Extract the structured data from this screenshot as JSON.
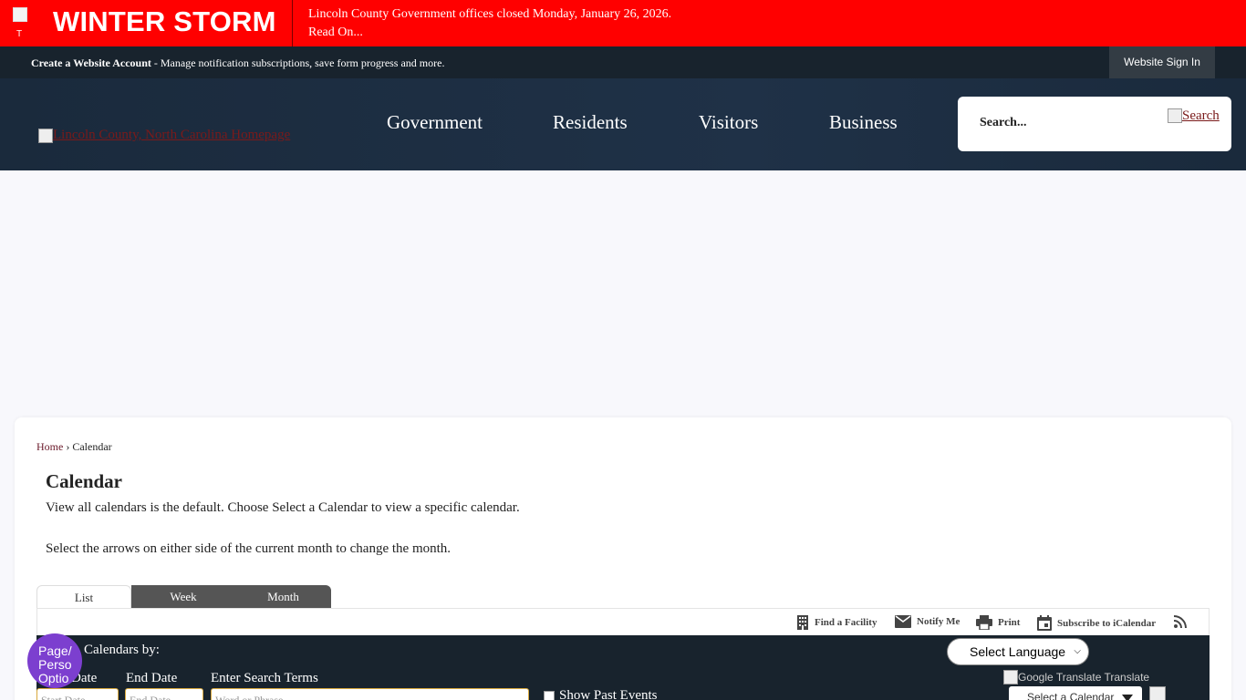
{
  "alert": {
    "title": "WINTER STORM",
    "icon_alt": "T",
    "message_line1": "Lincoln County Government offices closed Monday, January 26, 2026.",
    "message_line2": "Read On..."
  },
  "account_bar": {
    "create_account": "Create a Website Account",
    "create_account_desc": " - Manage notification subscriptions, save form progress and more.",
    "sign_in": "Website Sign In"
  },
  "header": {
    "logo_alt": "Lincoln County, North Carolina Homepage",
    "nav": [
      "Government",
      "Residents",
      "Visitors",
      "Business"
    ],
    "search_placeholder": "Search...",
    "search_button": "Search"
  },
  "breadcrumb": {
    "home": "Home",
    "separator": " › ",
    "current": "Calendar"
  },
  "page": {
    "title": "Calendar",
    "desc1": "View all calendars is the default. Choose Select a Calendar to view a specific calendar.",
    "desc2": "Select the arrows on either side of the current month to change the month."
  },
  "tabs": {
    "list": "List",
    "week": "Week",
    "month": "Month"
  },
  "toolbar": {
    "find_facility": "Find a Facility",
    "notify_me": "Notify Me",
    "print": "Print",
    "subscribe": "Subscribe to iCalendar"
  },
  "filter": {
    "title": "Calendars by:",
    "language": "Select Language",
    "google_translate": "Google Translate Translate",
    "start_date_label": "Date",
    "start_date_placeholder": "Start Date",
    "end_date_label": "End Date",
    "end_date_placeholder": "End Date",
    "search_terms_label": "Enter Search Terms",
    "search_terms_placeholder": "Word or Phrase",
    "show_past": "Show Past Events",
    "calendar_select": "Select a Calendar"
  },
  "page_options": "Page/ Perso Optio",
  "colors": {
    "alert": "#ff0000",
    "dark_bar": "#18232d",
    "header": "#1f3147",
    "page_options": "#7c3fcf"
  }
}
